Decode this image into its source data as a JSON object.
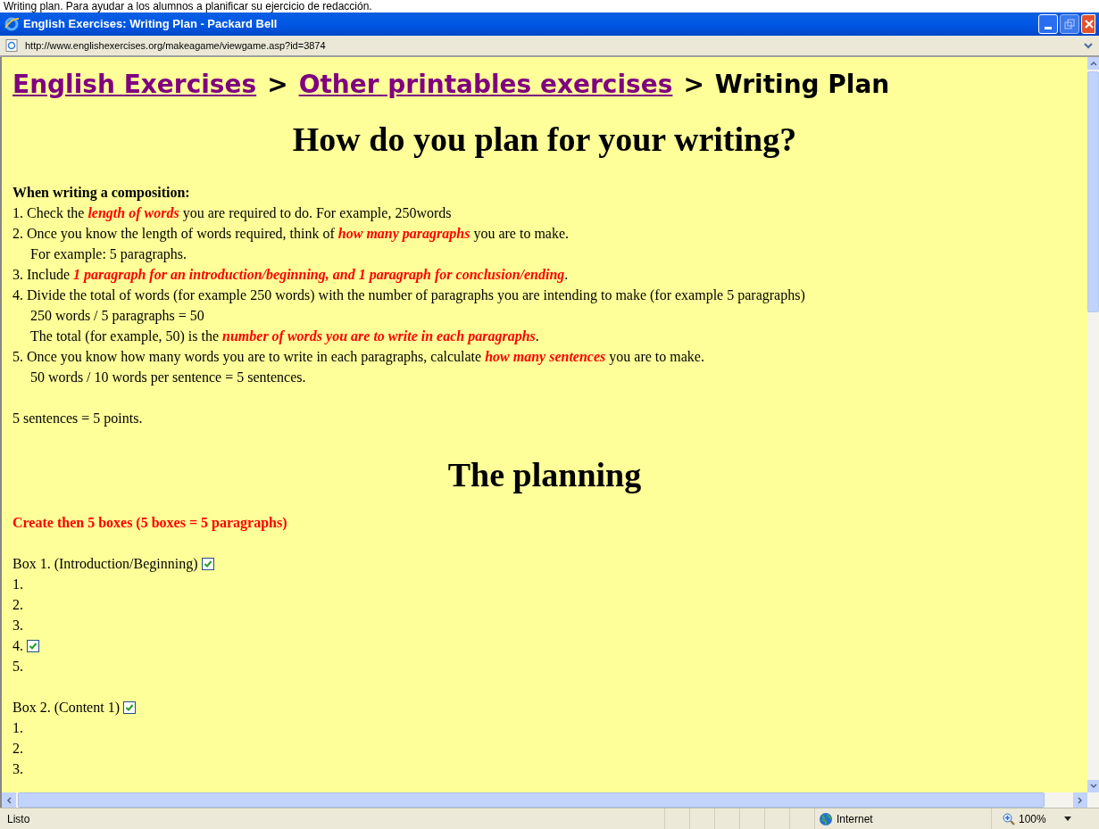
{
  "caption": "Writing plan. Para ayudar a los alumnos a planificar su ejercicio de redacción.",
  "window": {
    "title": "English Exercises: Writing Plan - Packard Bell"
  },
  "address_bar": {
    "url": "http://www.englishexercises.org/makeagame/viewgame.asp?id=3874"
  },
  "breadcrumb": [
    {
      "label": "English Exercises",
      "kind": "link"
    },
    {
      "label": ">",
      "kind": "separator"
    },
    {
      "label": "Other printables exercises",
      "kind": "link"
    },
    {
      "label": ">",
      "kind": "separator"
    },
    {
      "label": "Writing Plan",
      "kind": "current"
    }
  ],
  "heading": "How do you plan for your writing?",
  "intro": "When writing a composition:",
  "steps": [
    {
      "text": "1. Check the **length of words** you are required to do. For example, 250words",
      "kind": "item"
    },
    {
      "text": "2. Once you know the length of words required, think of **how many paragraphs** you are to make.",
      "kind": "item"
    },
    {
      "text": "For example: 5 paragraphs.",
      "kind": "continuation"
    },
    {
      "text": "3. Include **1 paragraph for an introduction/beginning, and 1 paragraph for conclusion/ending**.",
      "kind": "item"
    },
    {
      "text": "4. Divide the total of words (for example 250 words) with the number of paragraphs you are intending to make (for example 5 paragraphs)",
      "kind": "item"
    },
    {
      "text": "250 words / 5 paragraphs = 50",
      "kind": "continuation"
    },
    {
      "text": "The total (for example, 50) is the **number of words you are to write in each paragraphs**.",
      "kind": "continuation"
    },
    {
      "text": "5. Once you know how many words you are to write in each paragraphs, calculate **how many sentences** you are to make.",
      "kind": "item"
    },
    {
      "text": "50 words / 10 words per sentence = 5 sentences.",
      "kind": "continuation"
    }
  ],
  "note": "5 sentences = 5 points.",
  "planning_heading": "The planning",
  "instruction": "Create then 5 boxes (5 boxes = 5 paragraphs)",
  "boxes": [
    {
      "title": "Box 1. (Introduction/Beginning)",
      "checked": true,
      "lines": [
        {
          "label": "1.",
          "checked": false
        },
        {
          "label": "2.",
          "checked": false
        },
        {
          "label": "3.",
          "checked": false
        },
        {
          "label": "4.",
          "checked": true
        },
        {
          "label": "5.",
          "checked": false
        }
      ]
    },
    {
      "title": "Box 2. (Content 1)",
      "checked": true,
      "lines": [
        {
          "label": "1.",
          "checked": false
        },
        {
          "label": "2.",
          "checked": false
        },
        {
          "label": "3.",
          "checked": false
        }
      ]
    }
  ],
  "status_bar": {
    "status": "Listo",
    "zone": "Internet",
    "zoom": "100%"
  }
}
